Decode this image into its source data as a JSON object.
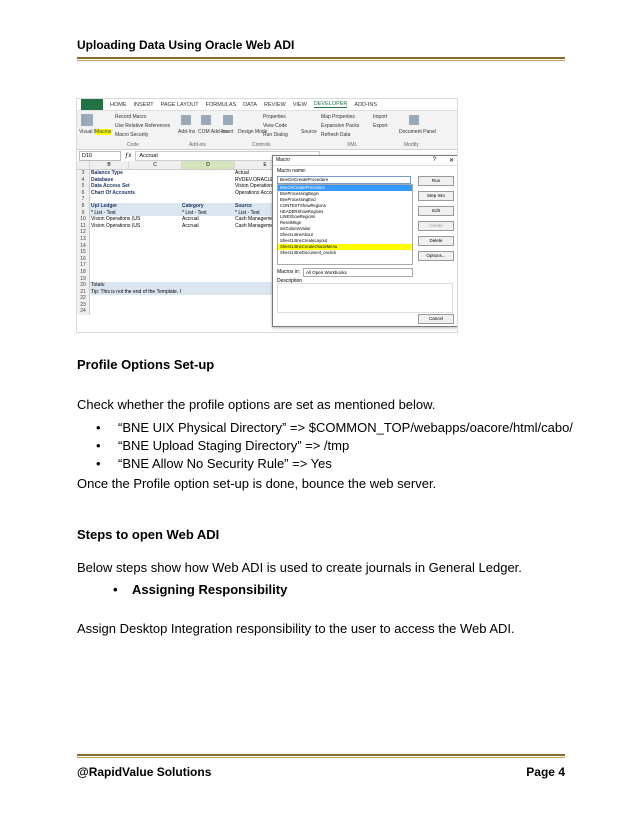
{
  "header": {
    "title": "Uploading Data Using Oracle Web ADI"
  },
  "screenshot": {
    "tabs": [
      "FILE",
      "HOME",
      "INSERT",
      "PAGE LAYOUT",
      "FORMULAS",
      "DATA",
      "REVIEW",
      "VIEW",
      "DEVELOPER",
      "ADD-INS"
    ],
    "active_tab": "DEVELOPER",
    "ribbon": {
      "visual_basic": "Visual Basic",
      "macros": "Macros",
      "record_macro": "Record Macro",
      "relative_refs": "Use Relative References",
      "macro_security": "Macro Security",
      "group_code": "Code",
      "add_ins": "Add-Ins",
      "com_add_ins": "COM Add-Ins",
      "group_addins": "Add-ins",
      "insert": "Insert",
      "design_mode": "Design Mode",
      "properties": "Properties",
      "view_code": "View Code",
      "run_dialog": "Run Dialog",
      "group_controls": "Controls",
      "source": "Source",
      "map_properties": "Map Properties",
      "expansion_packs": "Expansion Packs",
      "refresh_data": "Refresh Data",
      "import": "Import",
      "export": "Export",
      "group_xml": "XML",
      "document_panel": "Document Panel",
      "group_modify": "Modify"
    },
    "name_box": "D10",
    "formula_value": "Accrual",
    "columns": [
      "",
      "B",
      "C",
      "D",
      "E"
    ],
    "rows": [
      {
        "n": "3",
        "b": "Balance Type",
        "e": "Actual"
      },
      {
        "n": "4",
        "b": "Database",
        "e": "RVDEV.ORACLE.COM.RVDEV"
      },
      {
        "n": "5",
        "b": "Data Access Set",
        "e": "Vision Operations (USA)"
      },
      {
        "n": "6",
        "b": "Chart Of Accounts",
        "e": "Operations Accounting Flex"
      },
      {
        "n": "7",
        "b": "",
        "e": ""
      },
      {
        "n": "8",
        "b": "Upl  Ledger",
        "d": "Category",
        "e": "Source",
        "f": "Journ"
      },
      {
        "n": "9",
        "b": "* List - Text",
        "d": "* List - Text",
        "e": "* List - Text",
        "f": "* List"
      },
      {
        "n": "10",
        "b": "Vision Operations (US",
        "d": "Accrual",
        "e": "Cash Management",
        "f": "Test fo"
      },
      {
        "n": "11",
        "b": "Vision Operations (US",
        "d": "Accrual",
        "e": "Cash Management",
        "f": "Test fo"
      },
      {
        "n": "12",
        "b": ""
      },
      {
        "n": "13",
        "b": ""
      },
      {
        "n": "14",
        "b": ""
      },
      {
        "n": "15",
        "b": ""
      },
      {
        "n": "16",
        "b": ""
      },
      {
        "n": "17",
        "b": ""
      },
      {
        "n": "18",
        "b": ""
      },
      {
        "n": "19",
        "b": ""
      },
      {
        "n": "20",
        "b": "Totals:"
      },
      {
        "n": "21",
        "b": "Tip: This is not the end of the Template.  Unprotect the sheet and insert as"
      },
      {
        "n": "22",
        "b": ""
      },
      {
        "n": "23",
        "b": ""
      },
      {
        "n": "24",
        "b": ""
      }
    ],
    "dialog": {
      "title": "Macro",
      "help": "?",
      "close": "✕",
      "name_label": "Macro name:",
      "name_value": "BneOnCreateProcedure",
      "list": [
        "BneOnCreateProcedure",
        "BneProcessingBegin",
        "BneProcessingEnd",
        "CONTEXTShowRegions",
        "HEADERShowRegions",
        "LINEShowRegions",
        "ResetMsge",
        "setColumnValue",
        "Sheet1.BneAbout",
        "Sheet1.BneCreateLayout",
        "Sheet1.BneCreateOracleMenu",
        "Sheet1.BneDocument_onclick"
      ],
      "highlighted": "Sheet1.BneCreateOracleMenu",
      "buttons": [
        "Run",
        "Step Into",
        "Edit",
        "Create",
        "Delete",
        "Options..."
      ],
      "cancel": "Cancel",
      "macros_in_label": "Macros in:",
      "macros_in_value": "All Open Workbooks",
      "description_label": "Description"
    }
  },
  "body": {
    "profile_heading": "Profile Options Set-up",
    "profile_intro": "Check whether the profile options are set as mentioned below.",
    "profile_items": [
      "“BNE UIX Physical Directory” => $COMMON_TOP/webapps/oacore/html/cabo/",
      "“BNE Upload Staging Directory” => /tmp",
      "“BNE Allow No Security Rule” => Yes"
    ],
    "profile_after": "Once the Profile option set-up is done, bounce the web server.",
    "steps_heading": "Steps to open Web ADI",
    "steps_intro": "Below steps show how Web ADI is used to create journals in General Ledger.",
    "steps_item": "Assigning Responsibility",
    "steps_after": "Assign Desktop Integration responsibility to the user to access the Web ADI."
  },
  "footer": {
    "left": "@RapidValue Solutions",
    "right": "Page 4"
  },
  "colors": {
    "excel_green": "#217346",
    "highlight": "#ffff00",
    "rule": "#8b6b2a",
    "header_band": "#dce6f1"
  }
}
